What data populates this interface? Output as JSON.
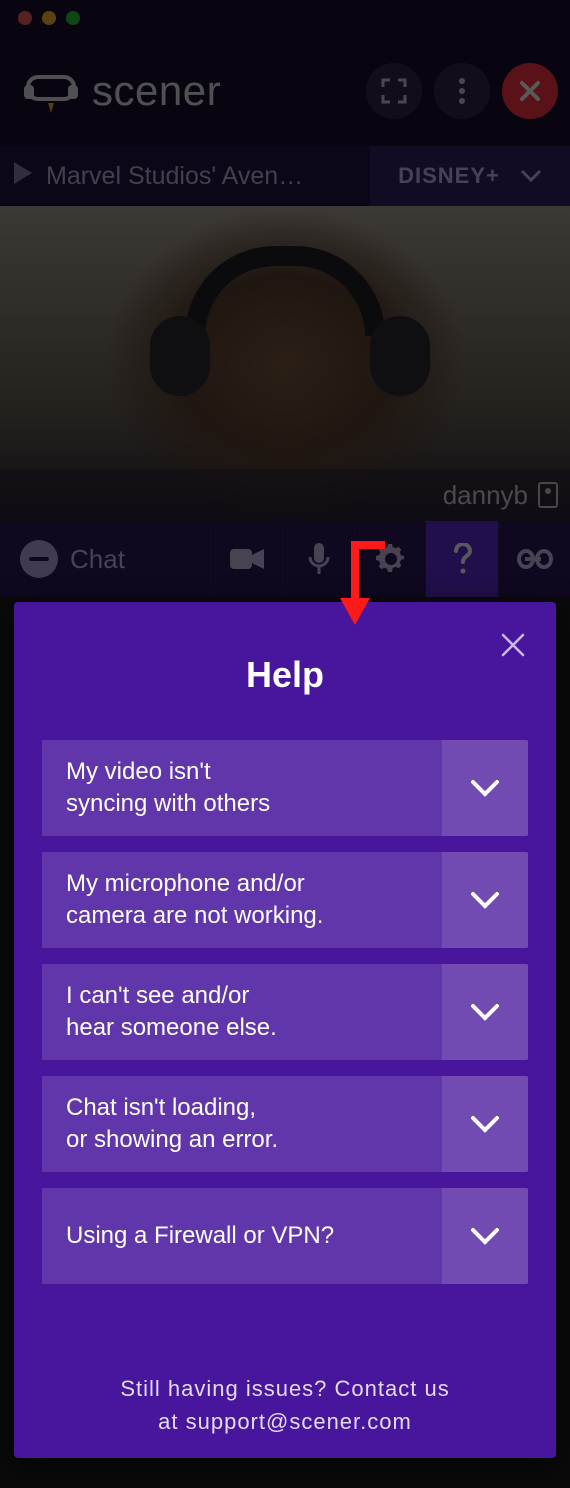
{
  "brand": {
    "name": "scener"
  },
  "header_buttons": {
    "fullscreen": "fullscreen",
    "menu": "menu",
    "close": "close"
  },
  "now_playing": {
    "title": "Marvel Studios' Aven…"
  },
  "service_selector": {
    "selected": "DISNEY+"
  },
  "video": {
    "username": "dannyb"
  },
  "toolbar": {
    "chat_label": "Chat",
    "items": [
      "camera",
      "microphone",
      "settings",
      "help",
      "link"
    ]
  },
  "help": {
    "title": "Help",
    "faqs": [
      "My video isn't\nsyncing with others",
      "My microphone and/or\ncamera are not working.",
      "I can't see and/or\nhear someone else.",
      "Chat isn't loading,\nor showing an error.",
      "Using a Firewall or VPN?"
    ],
    "footer": "Still having issues? Contact us\nat support@scener.com"
  }
}
